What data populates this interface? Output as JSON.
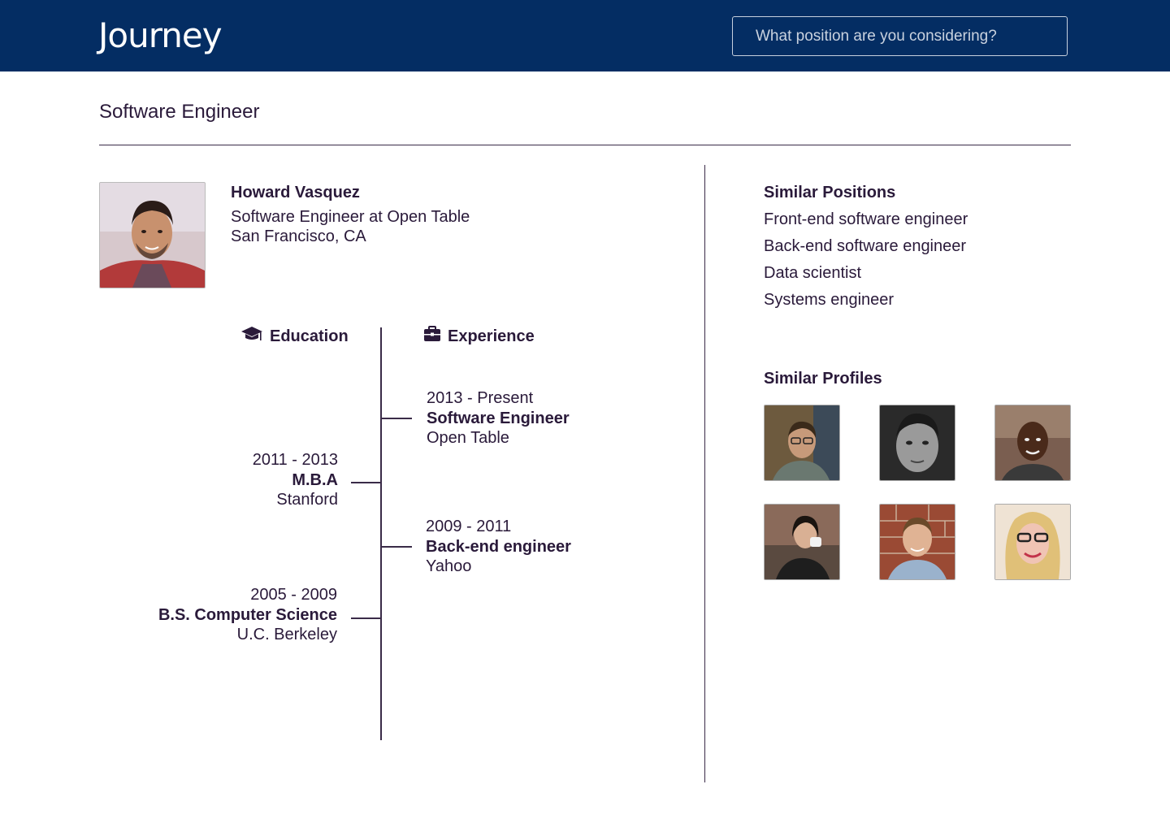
{
  "header": {
    "logo": "Journey",
    "search_placeholder": "What position are you considering?"
  },
  "page_title": "Software Engineer",
  "profile": {
    "name": "Howard Vasquez",
    "title": "Software Engineer at Open Table",
    "location": "San Francisco, CA"
  },
  "timeline": {
    "education_label": "Education",
    "experience_label": "Experience",
    "education": [
      {
        "years": "2011 - 2013",
        "degree": "M.B.A",
        "school": "Stanford"
      },
      {
        "years": "2005 - 2009",
        "degree": "B.S. Computer Science",
        "school": "U.C. Berkeley"
      }
    ],
    "experience": [
      {
        "years": "2013 - Present",
        "role": "Software Engineer",
        "company": "Open Table"
      },
      {
        "years": "2009 - 2011",
        "role": "Back-end engineer",
        "company": "Yahoo"
      }
    ]
  },
  "similar_positions": {
    "title": "Similar Positions",
    "items": [
      "Front-end software engineer",
      "Back-end software engineer",
      "Data scientist",
      "Systems engineer"
    ]
  },
  "similar_profiles": {
    "title": "Similar Profiles"
  },
  "colors": {
    "header_bg": "#042d63",
    "text": "#2a1a3a"
  },
  "icons": {
    "education": "graduation-cap-icon",
    "experience": "briefcase-icon"
  }
}
